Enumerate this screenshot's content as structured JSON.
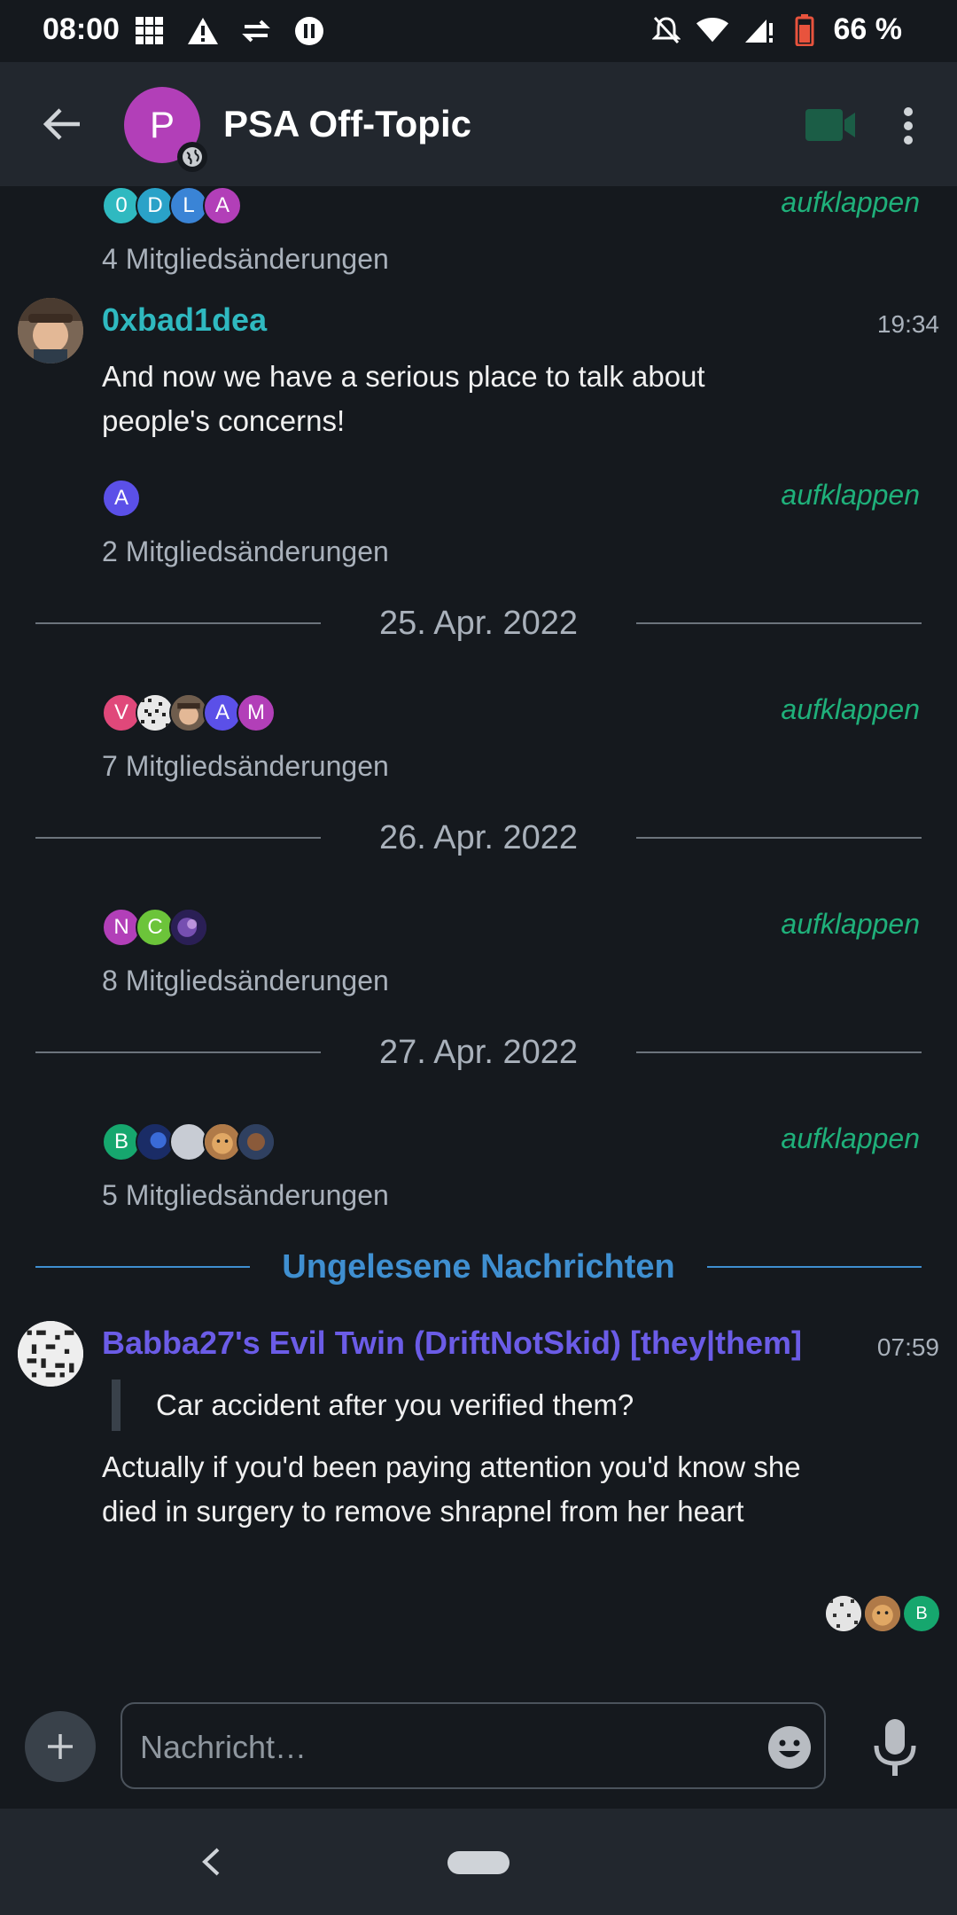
{
  "status_bar": {
    "time": "08:00",
    "battery_percent": "66 %"
  },
  "header": {
    "room_initial": "P",
    "room_name": "PSA Off-Topic"
  },
  "timeline": {
    "group1": {
      "initials": [
        "0",
        "D",
        "L",
        "A"
      ],
      "expand": "aufklappen",
      "changes": "4 Mitgliedsänderungen"
    },
    "message1": {
      "sender": "0xbad1dea",
      "time": "19:34",
      "body": "And now we have a serious place to talk about people's concerns!"
    },
    "group2": {
      "initials": [
        "A"
      ],
      "expand": "aufklappen",
      "changes": "2 Mitgliedsänderungen"
    },
    "date1": "25. Apr. 2022",
    "group3": {
      "initials": [
        "V",
        "A",
        "M"
      ],
      "expand": "aufklappen",
      "changes": "7 Mitgliedsänderungen"
    },
    "date2": "26. Apr. 2022",
    "group4": {
      "initials": [
        "N",
        "C"
      ],
      "expand": "aufklappen",
      "changes": "8 Mitgliedsänderungen"
    },
    "date3": "27. Apr. 2022",
    "group5": {
      "initials": [
        "B"
      ],
      "expand": "aufklappen",
      "changes": "5 Mitgliedsänderungen"
    },
    "unread_label": "Ungelesene Nachrichten",
    "message2": {
      "sender": "Babba27's Evil Twin (DriftNotSkid) [they|them]",
      "time": "07:59",
      "quote": "Car accident after you verified them?",
      "body": "Actually if you'd been paying attention you'd know she died in surgery to remove shrapnel from her heart"
    },
    "read_receipt_initial": "B"
  },
  "composer": {
    "placeholder": "Nachricht…"
  },
  "colors": {
    "background": "#15191e",
    "appbar": "#22272e",
    "accent_green": "#1fb07a",
    "sender1": "#2fb9c0",
    "sender2": "#6b5ce7",
    "unread": "#3f8fd0"
  },
  "icons": {
    "status_left": [
      "grid-icon",
      "warning-icon",
      "data-sync-icon",
      "pause-icon"
    ],
    "status_right": [
      "mute-icon",
      "wifi-icon",
      "signal-icon",
      "battery-icon"
    ],
    "header": [
      "back-arrow-icon",
      "globe-icon",
      "video-call-icon",
      "more-vert-icon"
    ],
    "composer": [
      "plus-icon",
      "emoji-icon",
      "microphone-icon"
    ],
    "navbar": [
      "nav-back-icon",
      "home-pill"
    ]
  }
}
